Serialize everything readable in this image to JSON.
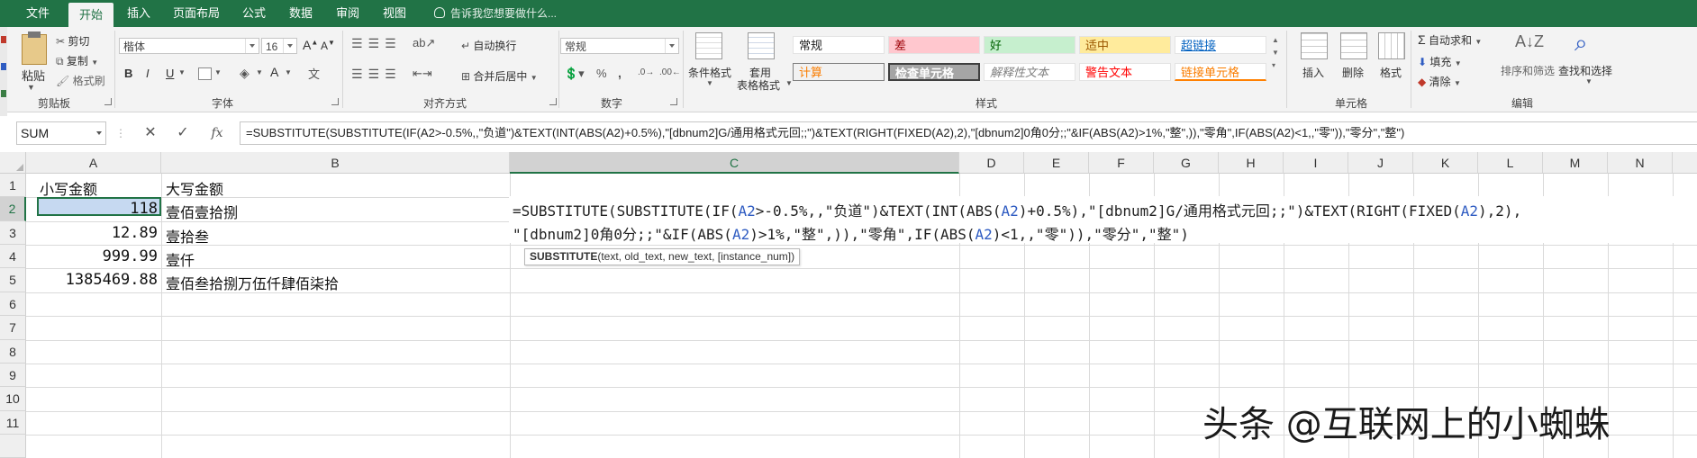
{
  "tabs": [
    "文件",
    "开始",
    "插入",
    "页面布局",
    "公式",
    "数据",
    "审阅",
    "视图"
  ],
  "active_tab": "开始",
  "tell_me": "告诉我您想要做什么...",
  "clipboard": {
    "paste": "粘贴",
    "cut": "剪切",
    "copy": "复制",
    "format_painter": "格式刷",
    "label": "剪贴板"
  },
  "font": {
    "family": "楷体",
    "size": "16",
    "label": "字体",
    "bold": "B",
    "italic": "I",
    "underline": "U"
  },
  "alignment": {
    "wrap": "自动换行",
    "merge": "合并后居中",
    "label": "对齐方式"
  },
  "number": {
    "format": "常规",
    "percent": "%",
    "comma": ",",
    "label": "数字"
  },
  "styles": {
    "conditional": "条件格式",
    "table_format_1": "套用",
    "table_format_2": "表格格式",
    "cells": [
      "常规",
      "差",
      "好",
      "适中",
      "超链接",
      "计算",
      "检查单元格",
      "解释性文本",
      "警告文本",
      "链接单元格"
    ],
    "label": "样式"
  },
  "cells_group": {
    "insert": "插入",
    "delete": "删除",
    "format": "格式",
    "label": "单元格"
  },
  "editing": {
    "autosum": "自动求和",
    "fill": "填充",
    "clear": "清除",
    "sort_filter": "排序和筛选",
    "find_select": "查找和选择",
    "label": "编辑"
  },
  "formula_bar": {
    "name_box": "SUM",
    "cancel": "✕",
    "enter": "✓",
    "fx": "fx",
    "formula": "=SUBSTITUTE(SUBSTITUTE(IF(A2>-0.5%,,\"负道\")&TEXT(INT(ABS(A2)+0.5%),\"[dbnum2]G/通用格式元回;;\")&TEXT(RIGHT(FIXED(A2),2),\"[dbnum2]0角0分;;\"&IF(ABS(A2)>1%,\"整\",)),\"零角\",IF(ABS(A2)<1,,\"零\")),\"零分\",\"整\")"
  },
  "columns": [
    "A",
    "B",
    "C",
    "D",
    "E",
    "F",
    "G",
    "H",
    "I",
    "J",
    "K",
    "L",
    "M",
    "N"
  ],
  "rows": [
    "1",
    "2",
    "3",
    "4",
    "5",
    "6",
    "7",
    "8",
    "9",
    "10",
    "11"
  ],
  "cells": {
    "a1": "小写金额",
    "b1": "大写金额",
    "a2": "118",
    "b2": "壹佰壹拾捌",
    "a3": "12.89",
    "b3": "壹拾叁",
    "a4": "999.99",
    "b4": "壹仟",
    "a5": "1385469.88",
    "b5": "壹佰叁拾捌万伍仟肆佰柒拾"
  },
  "editor": {
    "line1_a": "=SUBSTITUTE(SUBSTITUTE(IF(",
    "line1_ref1": "A2",
    "line1_b": ">-0.5%,,\"负道\")&TEXT(INT(ABS(",
    "line1_ref2": "A2",
    "line1_c": ")+0.5%),\"[dbnum2]G/通用格式元回;;\")&TEXT(RIGHT(FIXED(",
    "line1_ref3": "A2",
    "line1_d": "),2),",
    "line2_a": "\"[dbnum2]0角0分;;\"&IF(ABS(",
    "line2_ref1": "A2",
    "line2_b": ")>1%,\"整\",)),\"零角\",IF(ABS(",
    "line2_ref2": "A2",
    "line2_c": ")<1,,\"零\")),\"零分\",\"整\")"
  },
  "tooltip": {
    "fn": "SUBSTITUTE",
    "args": "(text, old_text, new_text, [instance_num])"
  },
  "watermark": "头条 @互联网上的小蜘蛛",
  "colors": {
    "accent": "#217346",
    "selection": "#c6d9f1",
    "ref_blue": "#2f5cc2"
  }
}
